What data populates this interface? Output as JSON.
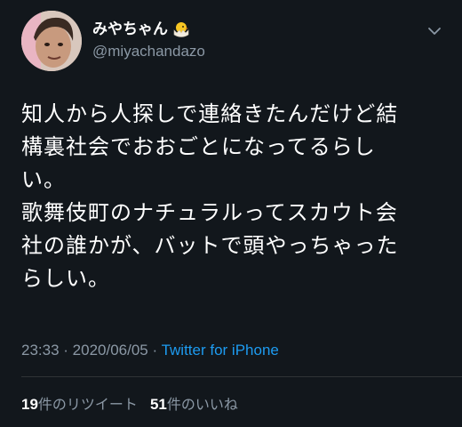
{
  "user": {
    "display_name": "みやちゃん",
    "name_emoji_icon": "hatching-chick-icon",
    "handle": "@miyachandazo",
    "avatar_icon": "avatar"
  },
  "header": {
    "menu_icon": "chevron-down-icon"
  },
  "tweet": {
    "lines": [
      "知人から人探しで連絡きたんだけど結",
      "構裏社会でおおごとになってるらし",
      "い。",
      "歌舞伎町のナチュラルってスカウト会",
      "社の誰かが、バットで頭やっちゃった",
      "らしい。"
    ],
    "time": "23:33",
    "separator": "·",
    "date": "2020/06/05",
    "source": "Twitter for iPhone"
  },
  "stats": {
    "retweets_count": "19",
    "retweets_label": "件のリツイート",
    "likes_count": "51",
    "likes_label": "件のいいね"
  },
  "colors": {
    "background": "#12171c",
    "text": "#ffffff",
    "muted": "#8b98a5",
    "link": "#1d9bf0"
  }
}
